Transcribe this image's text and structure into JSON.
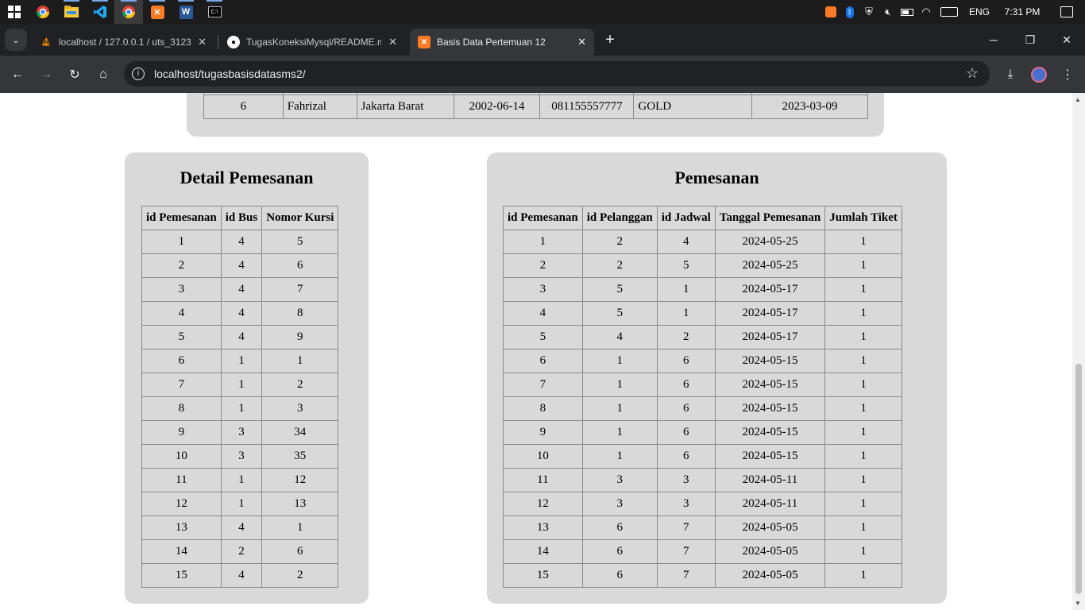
{
  "taskbar": {
    "apps": [
      "windows-start",
      "chrome",
      "file-explorer",
      "vscode",
      "chrome-active",
      "xampp",
      "word",
      "terminal"
    ],
    "tray": {
      "language": "ENG",
      "time": "7:31 PM"
    }
  },
  "browser": {
    "tabs": [
      {
        "title": "localhost / 127.0.0.1 / uts_3123",
        "favicon": "phpmyadmin-icon",
        "active": false
      },
      {
        "title": "TugasKoneksiMysql/README.m",
        "favicon": "github-icon",
        "active": false
      },
      {
        "title": "Basis Data Pertemuan 12",
        "favicon": "xampp-icon",
        "active": true
      }
    ],
    "url": "localhost/tugasbasisdatasms2/"
  },
  "top_table": {
    "row": [
      "6",
      "Fahrizal",
      "Jakarta Barat",
      "2002-06-14",
      "081155557777",
      "GOLD",
      "2023-03-09"
    ]
  },
  "detail": {
    "title": "Detail Pemesanan",
    "headers": [
      "id Pemesanan",
      "id Bus",
      "Nomor Kursi"
    ],
    "rows": [
      [
        "1",
        "4",
        "5"
      ],
      [
        "2",
        "4",
        "6"
      ],
      [
        "3",
        "4",
        "7"
      ],
      [
        "4",
        "4",
        "8"
      ],
      [
        "5",
        "4",
        "9"
      ],
      [
        "6",
        "1",
        "1"
      ],
      [
        "7",
        "1",
        "2"
      ],
      [
        "8",
        "1",
        "3"
      ],
      [
        "9",
        "3",
        "34"
      ],
      [
        "10",
        "3",
        "35"
      ],
      [
        "11",
        "1",
        "12"
      ],
      [
        "12",
        "1",
        "13"
      ],
      [
        "13",
        "4",
        "1"
      ],
      [
        "14",
        "2",
        "6"
      ],
      [
        "15",
        "4",
        "2"
      ]
    ]
  },
  "pemesanan": {
    "title": "Pemesanan",
    "headers": [
      "id Pemesanan",
      "id Pelanggan",
      "id Jadwal",
      "Tanggal Pemesanan",
      "Jumlah Tiket"
    ],
    "rows": [
      [
        "1",
        "2",
        "4",
        "2024-05-25",
        "1"
      ],
      [
        "2",
        "2",
        "5",
        "2024-05-25",
        "1"
      ],
      [
        "3",
        "5",
        "1",
        "2024-05-17",
        "1"
      ],
      [
        "4",
        "5",
        "1",
        "2024-05-17",
        "1"
      ],
      [
        "5",
        "4",
        "2",
        "2024-05-17",
        "1"
      ],
      [
        "6",
        "1",
        "6",
        "2024-05-15",
        "1"
      ],
      [
        "7",
        "1",
        "6",
        "2024-05-15",
        "1"
      ],
      [
        "8",
        "1",
        "6",
        "2024-05-15",
        "1"
      ],
      [
        "9",
        "1",
        "6",
        "2024-05-15",
        "1"
      ],
      [
        "10",
        "1",
        "6",
        "2024-05-15",
        "1"
      ],
      [
        "11",
        "3",
        "3",
        "2024-05-11",
        "1"
      ],
      [
        "12",
        "3",
        "3",
        "2024-05-11",
        "1"
      ],
      [
        "13",
        "6",
        "7",
        "2024-05-05",
        "1"
      ],
      [
        "14",
        "6",
        "7",
        "2024-05-05",
        "1"
      ],
      [
        "15",
        "6",
        "7",
        "2024-05-05",
        "1"
      ]
    ]
  }
}
